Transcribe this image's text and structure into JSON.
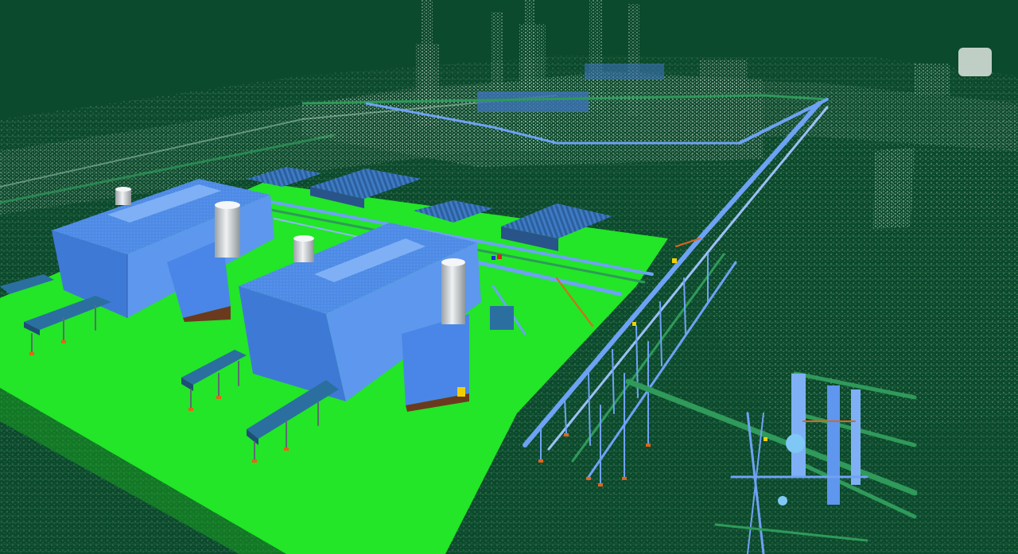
{
  "scene": {
    "type": "3d-point-cloud-plant-model",
    "colors": {
      "background": "#0b4a2c",
      "point_cloud": "#cfd8d2",
      "ground_pad": "#22e627",
      "building": "#4a86e8",
      "building_roof": "#5b93f0",
      "stack": "#d9d9d9",
      "pipe_rack": "#6ea2f4",
      "pipe_green": "#1f9a57",
      "steel_orange": "#e0641c",
      "cooler": "#2b6fa0"
    }
  }
}
